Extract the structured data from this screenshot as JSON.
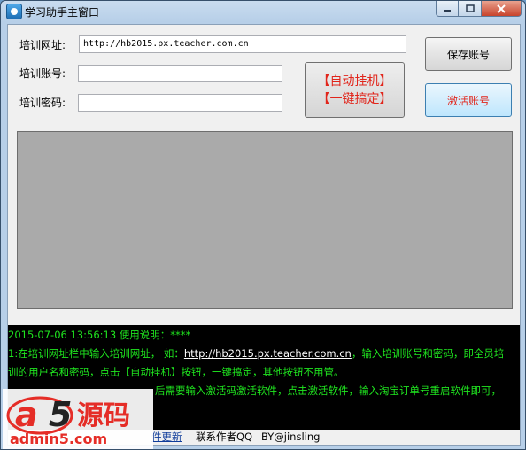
{
  "window": {
    "title": "学习助手主窗口"
  },
  "form": {
    "url_label": "培训网址:",
    "url_value": "http://hb2015.px.teacher.com.cn",
    "account_label": "培训账号:",
    "account_value": "",
    "password_label": "培训密码:",
    "password_value": ""
  },
  "buttons": {
    "auto_line1": "【自动挂机】",
    "auto_line2": "【一键搞定】",
    "save_account": "保存账号",
    "activate_account": "激活账号"
  },
  "log": {
    "line1": "2015-07-06 13:56:13 使用说明：****",
    "line2_prefix": "1:在培训网址栏中输入培训网址， 如：",
    "line2_link": "http://hb2015.px.teacher.com.cn",
    "line2_suffix": "，输入培训账号和密码，即全员培",
    "line3": "训的用户名和密码，点击【自动挂机】按钮，一键搞定，其他按钮不用管。",
    "line4": "后需要输入激活码激活软件，点击激活软件，输入淘宝订单号重启软件即可，"
  },
  "status": {
    "update_link": "件更新",
    "contact_author": "联系作者QQ",
    "by": "BY@jinsling"
  },
  "watermark": {
    "logo_a": "a",
    "logo_5": "5",
    "logo_text": "源码",
    "site": "admin5.com"
  },
  "colors": {
    "log_text": "#1fe61f",
    "accent_red": "#e1251b",
    "log_bg": "#000000",
    "panel_gray": "#aaaaaa"
  }
}
